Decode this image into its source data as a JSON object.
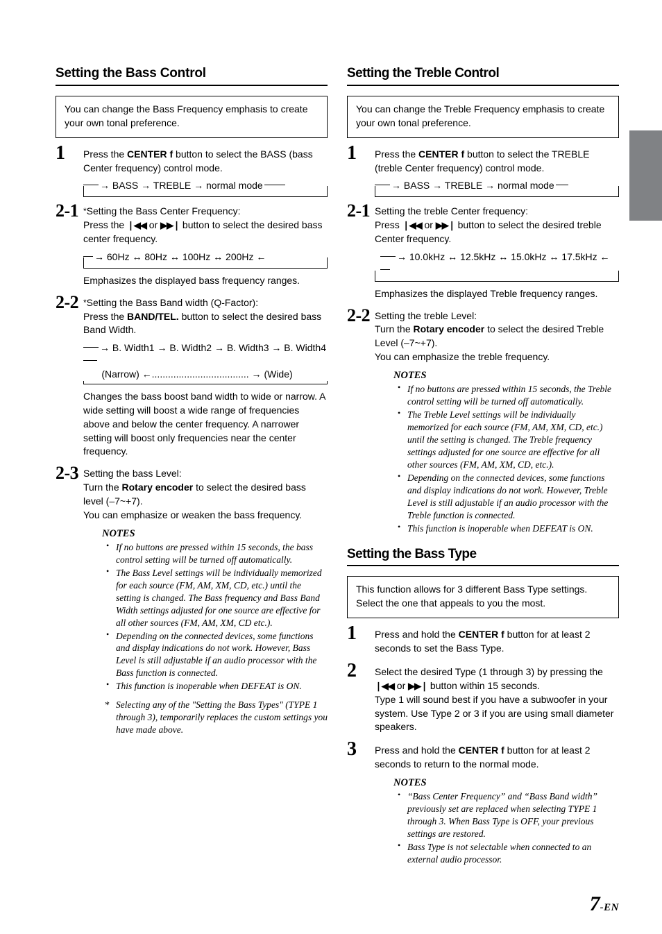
{
  "page": {
    "folio_number": "7",
    "folio_suffix": "-EN"
  },
  "thumb_tab": {
    "color": "#808285"
  },
  "sections": {
    "bass_control": {
      "heading": "Setting the Bass Control",
      "callout": "You can change the Bass Frequency emphasis to create your own tonal preference.",
      "step1": {
        "num": "1",
        "text_before": "Press the ",
        "bold": "CENTER f",
        "text_after": " button to select the BASS (bass Center frequency) control mode."
      },
      "loop1": {
        "text": "→ BASS → TREBLE → normal mode"
      },
      "step21": {
        "num": "2-1",
        "asterisk": "*",
        "title": "Setting the Bass Center Frequency:",
        "line_a": "Press the ",
        "prev_glyph": "❘◀◀",
        "or": " or ",
        "next_glyph": "▶▶❘",
        "line_b": " button to select the desired bass center frequency."
      },
      "loop2": {
        "text": "→  60Hz  ↔  80Hz  ↔  100Hz  ↔  200Hz  ←"
      },
      "after_loop2": "Emphasizes the displayed bass frequency ranges.",
      "step22": {
        "num": "2-2",
        "asterisk": "*",
        "title": "Setting the Bass Band width (Q-Factor):",
        "line_a": "Press the ",
        "bold": "BAND/TEL.",
        "line_b": " button to select the desired bass Band Width."
      },
      "loop3": {
        "row1": "→ B. Width1 → B. Width2 → B. Width3 → B. Width4",
        "row2": "(Narrow) ←.................................... → (Wide)"
      },
      "after_loop3": "Changes the bass boost band width to wide or narrow. A wide setting will boost a wide range of frequencies above and below the center frequency. A narrower setting will boost only frequencies near the center frequency.",
      "step23": {
        "num": "2-3",
        "title": "Setting the bass Level:",
        "line_a": "Turn the ",
        "bold": "Rotary encoder",
        "line_b": " to select the desired bass level (–7~+7).",
        "line_c": "You can emphasize or weaken the bass frequency."
      },
      "notes_heading": "NOTES",
      "notes": [
        "If no buttons are pressed within 15 seconds, the bass control setting will be turned off automatically.",
        "The Bass Level settings will be individually memorized for each source (FM, AM, XM, CD, etc.) until the setting is changed. The Bass frequency and Bass Band Width settings adjusted for one source are effective for all other sources (FM, AM, XM, CD etc.).",
        "Depending on the connected devices, some functions and display indications do not work. However, Bass Level is still adjustable if an audio processor with the Bass function is connected.",
        "This function is inoperable when DEFEAT is ON."
      ],
      "footnote": "Selecting any of the \"Setting the Bass Types\" (TYPE 1 through 3), temporarily replaces the custom settings you have made above."
    },
    "treble_control": {
      "heading": "Setting the Treble Control",
      "callout": "You can change the Treble Frequency emphasis to create your own tonal preference.",
      "step1": {
        "num": "1",
        "text_before": "Press the ",
        "bold": "CENTER f",
        "text_after": " button to select the TREBLE (treble Center frequency) control mode."
      },
      "loop1": {
        "text": "→ BASS → TREBLE → normal mode"
      },
      "step21": {
        "num": "2-1",
        "title": "Setting the treble Center frequency:",
        "line_a": "Press ",
        "prev_glyph": "❘◀◀",
        "or": " or ",
        "next_glyph": "▶▶❘",
        "line_b": " button to select the desired treble Center frequency."
      },
      "loop2": {
        "text": "→ 10.0kHz ↔ 12.5kHz ↔ 15.0kHz ↔ 17.5kHz ←"
      },
      "after_loop2": "Emphasizes the displayed Treble frequency ranges.",
      "step22": {
        "num": "2-2",
        "title": "Setting the treble Level:",
        "line_a": "Turn the ",
        "bold": "Rotary encoder",
        "line_b": " to select the desired Treble Level (–7~+7).",
        "line_c": "You can emphasize the treble frequency."
      },
      "notes_heading": "NOTES",
      "notes": [
        "If no buttons are pressed within 15 seconds, the Treble control setting will be turned off automatically.",
        "The Treble Level settings will be individually memorized for each source (FM, AM, XM, CD, etc.) until the setting is changed. The Treble frequency settings adjusted for one source are effective for all other sources (FM, AM, XM, CD, etc.).",
        "Depending on the connected devices, some functions and display indications do not work. However, Treble Level is still adjustable if an audio processor with the Treble function is connected.",
        "This function is inoperable when DEFEAT is ON."
      ]
    },
    "bass_type": {
      "heading": "Setting the Bass Type",
      "callout": "This function allows for 3 different Bass Type settings. Select the one that appeals to you the most.",
      "step1": {
        "num": "1",
        "text_before": "Press and hold the ",
        "bold": "CENTER f",
        "text_after": " button for at least 2 seconds to set the Bass Type."
      },
      "step2": {
        "num": "2",
        "line_a": "Select the desired Type (1 through 3) by pressing the ",
        "prev_glyph": "❘◀◀",
        "or": " or  ",
        "next_glyph": "▶▶❘",
        "line_b": " button within 15 seconds.",
        "line_c": "Type 1 will sound best if you have a subwoofer in your system. Use Type 2 or 3 if you are using small diameter speakers."
      },
      "step3": {
        "num": "3",
        "text_before": "Press and hold the ",
        "bold": "CENTER f",
        "text_after": " button for at least 2 seconds to return to the normal mode."
      },
      "notes_heading": "NOTES",
      "notes": [
        "“Bass Center Frequency” and “Bass Band width” previously set are replaced when selecting TYPE 1 through 3. When Bass Type is OFF, your previous settings are restored.",
        "Bass Type is not selectable when connected to an external audio processor."
      ]
    }
  }
}
